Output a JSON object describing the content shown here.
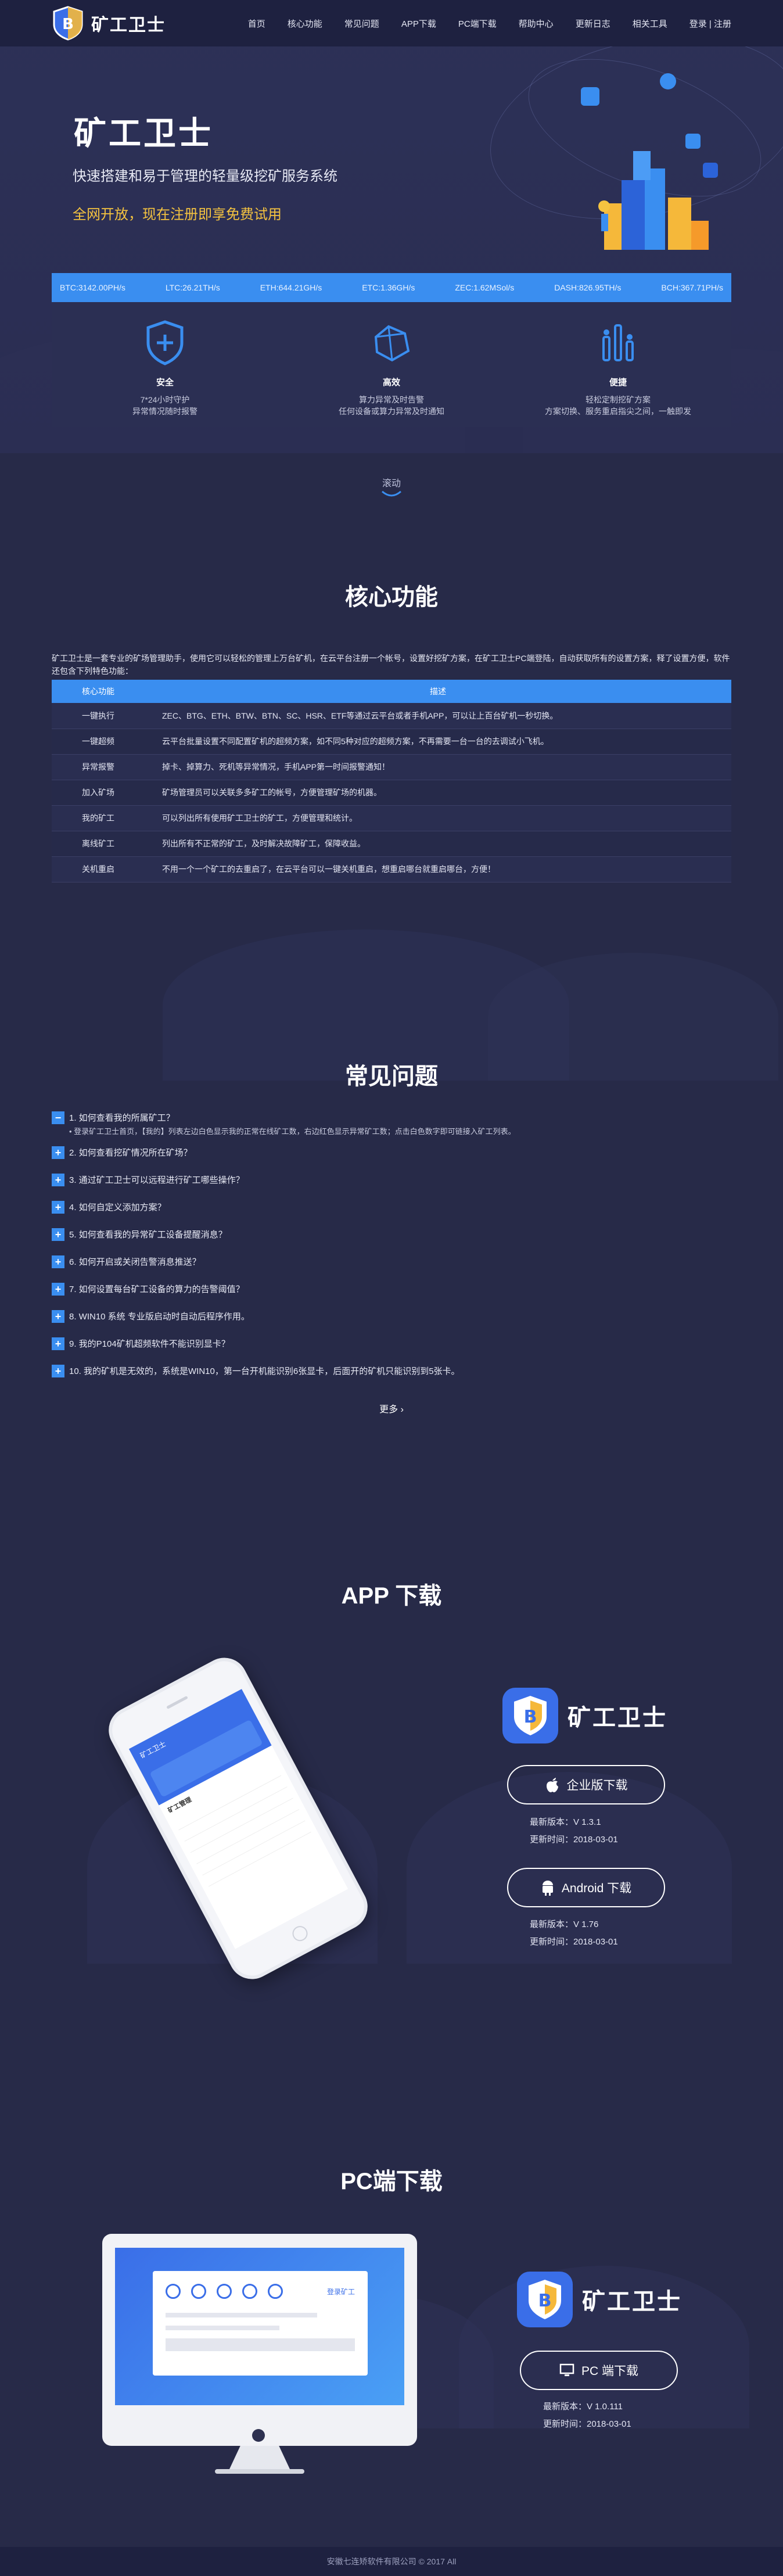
{
  "header": {
    "brand": "矿工卫士",
    "nav": [
      "首页",
      "核心功能",
      "常见问题",
      "APP下载",
      "PC端下载",
      "帮助中心",
      "更新日志",
      "相关工具"
    ],
    "login": "登录",
    "register": "注册"
  },
  "hero": {
    "title": "矿工卫士",
    "subtitle": "快速搭建和易于管理的轻量级挖矿服务系统",
    "cta": "全网开放，现在注册即享免费试用"
  },
  "ticker": [
    "BTC:3142.00PH/s",
    "LTC:26.21TH/s",
    "ETH:644.21GH/s",
    "ETC:1.36GH/s",
    "ZEC:1.62MSol/s",
    "DASH:826.95TH/s",
    "BCH:367.71PH/s"
  ],
  "features": [
    {
      "title": "安全",
      "line1": "7*24小时守护",
      "line2": "异常情况随时报警"
    },
    {
      "title": "高效",
      "line1": "算力异常及时告警",
      "line2": "任何设备或算力异常及时通知"
    },
    {
      "title": "便捷",
      "line1": "轻松定制挖矿方案",
      "line2": "方案切换、服务重启指尖之间，一触即发"
    }
  ],
  "scroll_label": "滚动",
  "core": {
    "title": "核心功能",
    "intro": "矿工卫士是一套专业的矿场管理助手，使用它可以轻松的管理上万台矿机，在云平台注册一个帐号，设置好挖矿方案，在矿工卫士PC端登陆，自动获取所有的设置方案，释了设置方便，软件还包含下列特色功能：",
    "headers": [
      "核心功能",
      "描述"
    ],
    "rows": [
      [
        "一键执行",
        "ZEC、BTG、ETH、BTW、BTN、SC、HSR、ETF等通过云平台或者手机APP，可以让上百台矿机一秒切换。"
      ],
      [
        "一键超频",
        "云平台批量设置不同配置矿机的超频方案，如不同5种对应的超频方案，不再需要一台一台的去调试小飞机。"
      ],
      [
        "异常报警",
        "掉卡、掉算力、死机等异常情况，手机APP第一时间报警通知！"
      ],
      [
        "加入矿场",
        "矿场管理员可以关联多多矿工的帐号，方便管理矿场的机器。"
      ],
      [
        "我的矿工",
        "可以列出所有使用矿工卫士的矿工，方便管理和统计。"
      ],
      [
        "离线矿工",
        "列出所有不正常的矿工，及时解决故障矿工，保障收益。"
      ],
      [
        "关机重启",
        "不用一个一个矿工的去重启了，在云平台可以一键关机重启，想重启哪台就重启哪台，方便！"
      ]
    ]
  },
  "faq": {
    "title": "常见问题",
    "items": [
      "1. 如何查看我的所属矿工？",
      "2. 如何查看挖矿情况所在矿场？",
      "3. 通过矿工卫士可以远程进行矿工哪些操作？",
      "4. 如何自定义添加方案？",
      "5. 如何查看我的异常矿工设备提醒消息？",
      "6. 如何开启或关闭告警消息推送？",
      "7. 如何设置每台矿工设备的算力的告警阈值？",
      "8. WIN10 系统 专业版启动时自动后程序作用。",
      "9. 我的P104矿机超频软件不能识别显卡？",
      "10. 我的矿机是无效的，系统是WIN10，第一台开机能识别6张显卡，后面开的矿机只能识别到5张卡。"
    ],
    "answer": "• 登录矿工卫士首页，【我的】列表左边白色显示我的正常在线矿工数，右边红色显示异常矿工数；点击白色数字即可链接入矿工列表。",
    "more": "更多"
  },
  "app": {
    "title": "APP 下载",
    "brand": "矿工卫士",
    "ios_btn": "企业版下载",
    "ios_version": "最新版本：V 1.3.1",
    "ios_date": "更新时间：2018-03-01",
    "android_btn": "Android 下载",
    "android_version": "最新版本：V 1.76",
    "android_date": "更新时间：2018-03-01",
    "phone_title": "矿工卫士",
    "phone_list_title": "矿工管理"
  },
  "pc": {
    "title": "PC端下载",
    "brand": "矿工卫士",
    "btn": "PC 端下载",
    "version": "最新版本：V 1.0.111",
    "date": "更新时间：2018-03-01",
    "screen_link": "登录矿工"
  },
  "footer": {
    "copyright": "安徽七连矫软件有限公司 © 2017 All"
  },
  "colors": {
    "accent": "#3a8ef0",
    "bg": "#272a48",
    "header": "#1e2140",
    "cta": "#f5c340"
  }
}
